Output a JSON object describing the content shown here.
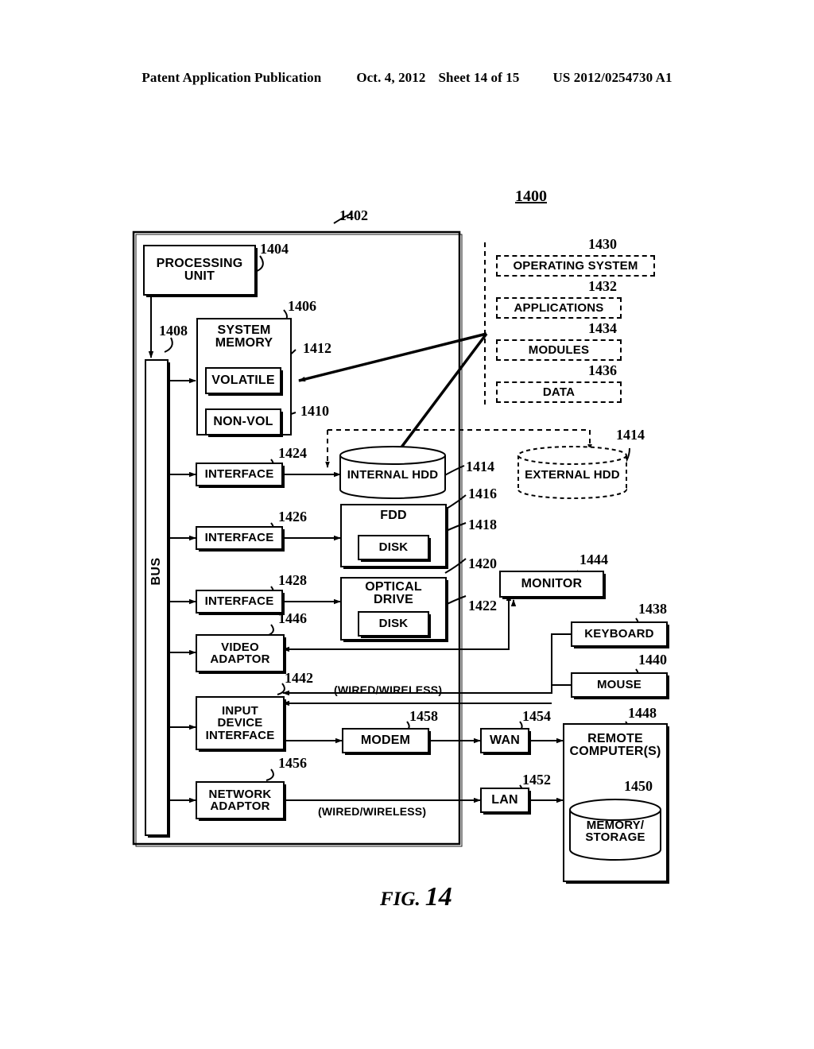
{
  "header": {
    "publication": "Patent Application Publication",
    "date": "Oct. 4, 2012",
    "sheet": "Sheet 14 of 15",
    "patent_number": "US 2012/0254730 A1"
  },
  "figure": {
    "caption_word": "FIG.",
    "caption_number": "14",
    "system_ref": "1400"
  },
  "blocks": {
    "computer_boundary": {
      "ref": "1402"
    },
    "processing_unit": {
      "label": "PROCESSING\nUNIT",
      "ref": "1404"
    },
    "system_memory": {
      "label": "SYSTEM\nMEMORY",
      "ref": "1406"
    },
    "volatile": {
      "label": "VOLATILE",
      "ref": "1412"
    },
    "non_volatile": {
      "label": "NON-VOL",
      "ref": "1410"
    },
    "bus": {
      "label": "BUS",
      "ref": "1408"
    },
    "interface_hdd": {
      "label": "INTERFACE",
      "ref": "1424"
    },
    "interface_fdd": {
      "label": "INTERFACE",
      "ref": "1426"
    },
    "interface_optical": {
      "label": "INTERFACE",
      "ref": "1428"
    },
    "internal_hdd": {
      "label": "INTERNAL HDD",
      "ref": "1414"
    },
    "external_hdd": {
      "label": "EXTERNAL HDD",
      "ref": "1414"
    },
    "fdd": {
      "label": "FDD",
      "ref": "1416"
    },
    "fdd_disk": {
      "label": "DISK",
      "ref": "1418"
    },
    "optical_drive": {
      "label": "OPTICAL\nDRIVE",
      "ref": "1420"
    },
    "optical_disk": {
      "label": "DISK",
      "ref": "1422"
    },
    "video_adaptor": {
      "label": "VIDEO\nADAPTOR",
      "ref": "1446"
    },
    "monitor": {
      "label": "MONITOR",
      "ref": "1444"
    },
    "keyboard": {
      "label": "KEYBOARD",
      "ref": "1438"
    },
    "mouse": {
      "label": "MOUSE",
      "ref": "1440"
    },
    "input_device_interface": {
      "label": "INPUT\nDEVICE\nINTERFACE",
      "ref": "1442"
    },
    "modem": {
      "label": "MODEM",
      "ref": "1458"
    },
    "wan": {
      "label": "WAN",
      "ref": "1454"
    },
    "network_adaptor": {
      "label": "NETWORK\nADAPTOR",
      "ref": "1456"
    },
    "lan": {
      "label": "LAN",
      "ref": "1452"
    },
    "remote_computers": {
      "label": "REMOTE\nCOMPUTER(S)",
      "ref": "1448"
    },
    "memory_storage": {
      "label": "MEMORY/\nSTORAGE",
      "ref": "1450"
    },
    "operating_system": {
      "label": "OPERATING SYSTEM",
      "ref": "1430"
    },
    "applications": {
      "label": "APPLICATIONS",
      "ref": "1432"
    },
    "modules": {
      "label": "MODULES",
      "ref": "1434"
    },
    "data": {
      "label": "DATA",
      "ref": "1436"
    }
  },
  "annotations": {
    "wired_wireless_upper": "(WIRED/WIRELESS)",
    "wired_wireless_lower": "(WIRED/WIRELESS)"
  }
}
